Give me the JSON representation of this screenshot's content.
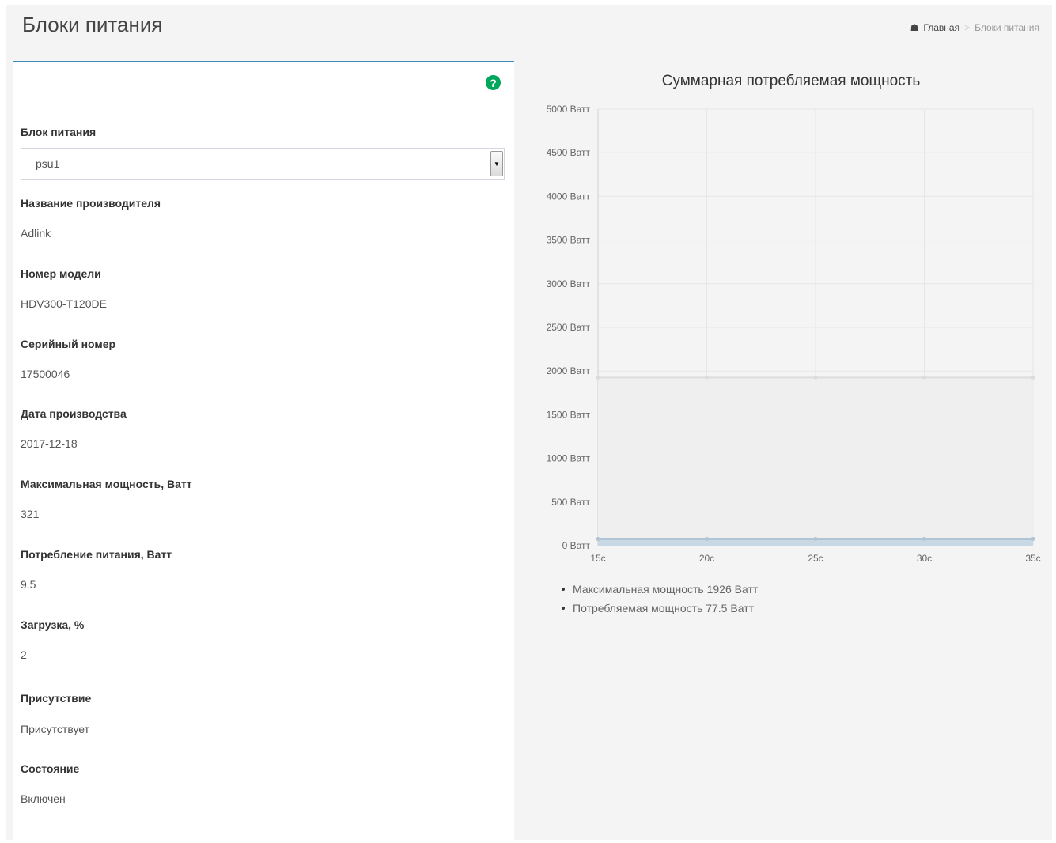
{
  "page": {
    "title": "Блоки питания",
    "breadcrumb": {
      "home_icon": "home-icon",
      "home": "Главная",
      "current": "Блоки питания"
    }
  },
  "panel": {
    "help_icon": "question-circle-icon",
    "fields": [
      {
        "label": "Блок питания",
        "value": "psu1",
        "type": "select"
      },
      {
        "label": "Название производителя",
        "value": "Adlink"
      },
      {
        "label": "Номер модели",
        "value": "HDV300-T120DE"
      },
      {
        "label": "Серийный номер",
        "value": "17500046"
      },
      {
        "label": "Дата производства",
        "value": "2017-12-18"
      },
      {
        "label": "Максимальная мощность, Ватт",
        "value": "321"
      },
      {
        "label": "Потребление питания, Ватт",
        "value": "9.5"
      },
      {
        "label": "Загрузка, %",
        "value": "2"
      },
      {
        "label": "Присутствие",
        "value": "Присутствует"
      },
      {
        "label": "Состояние",
        "value": "Включен"
      }
    ]
  },
  "chart_data": {
    "type": "area",
    "title": "Суммарная потребляемая мощность",
    "x": [
      "15с",
      "20с",
      "25с",
      "30с",
      "35с"
    ],
    "y_ticks": [
      "0 Ватт",
      "500 Ватт",
      "1000 Ватт",
      "1500 Ватт",
      "2000 Ватт",
      "2500 Ватт",
      "3000 Ватт",
      "3500 Ватт",
      "4000 Ватт",
      "4500 Ватт",
      "5000 Ватт"
    ],
    "ylim": [
      0,
      5000
    ],
    "grid": true,
    "legend_position": "bottom",
    "series": [
      {
        "name": "Максимальная мощность 1926 Ватт",
        "values": [
          1926,
          1926,
          1926,
          1926,
          1926
        ],
        "color": "#dcdcdc",
        "fill": "#efefef"
      },
      {
        "name": "Потребляемая мощность 77.5 Ватт",
        "values": [
          77.5,
          77.5,
          77.5,
          77.5,
          77.5
        ],
        "color": "#b0c4d4",
        "fill": "#c8d8e4"
      }
    ]
  }
}
